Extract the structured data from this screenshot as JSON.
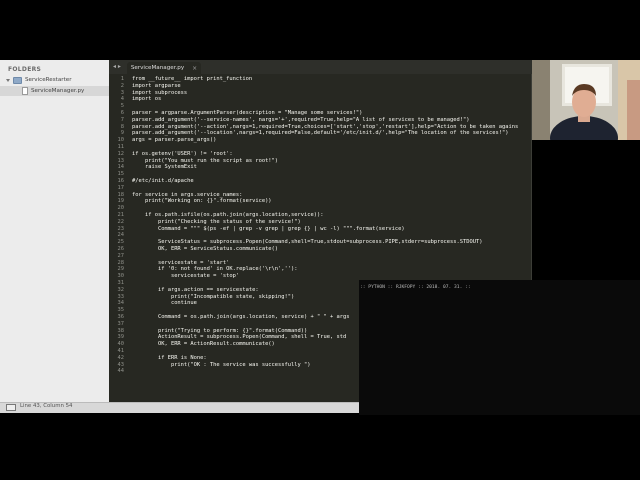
{
  "sidebar": {
    "title": "FOLDERS",
    "folder": "ServiceRestarter",
    "file": "ServiceManager.py"
  },
  "tab": {
    "label": "ServiceManager.py",
    "close": "×",
    "nav": "◂ ▸"
  },
  "status": {
    "text": "Line 43, Column 54"
  },
  "terminal": {
    "text": ":: PYTHON :: RJKFOPY :: 2018. 07. 31. ::"
  },
  "code_lines": [
    "from __future__ import print_function",
    "import argparse",
    "import subprocess",
    "import os",
    "",
    "parser = argparse.ArgumentParser(description = \"Manage some services!\")",
    "parser.add_argument('--service-names', nargs='+',required=True,help=\"A list of services to be managed!\")",
    "parser.add_argument('--action',nargs=1,required=True,choices=['start','stop','restart'],help=\"Action to be taken agains",
    "parser.add_argument('--location',nargs=1,required=False,default='/etc/init.d/',help=\"The location of the services!\")",
    "args = parser.parse_args()",
    "",
    "if os.getenv('USER') != 'root':",
    "    print(\"You must run the script as root!\")",
    "    raise SystemExit",
    "",
    "#/etc/init.d/apache",
    "",
    "for service in args.service_names:",
    "    print(\"Working on: {}\".format(service))",
    "",
    "    if os.path.isfile(os.path.join(args.location,service)):",
    "        print(\"Checking the status of the service!\")",
    "        Command = \"\"\" $(ps -ef | grep -v grep | grep {} | wc -l) \"\"\".format(service)",
    "",
    "        ServiceStatus = subprocess.Popen(Command,shell=True,stdout=subprocess.PIPE,stderr=subprocess.STDOUT)",
    "        OK, ERR = ServiceStatus.communicate()",
    "",
    "        servicestate = 'start'",
    "        if '0: not found' in OK.replace('\\r\\n',''):",
    "            servicestate = 'stop'",
    "",
    "        if args.action == servicestate:",
    "            print(\"Incompatible state, skipping!\")",
    "            continue",
    "",
    "        Command = os.path.join(args.location, service) + \" \" + args",
    "",
    "        print(\"Trying to perform: {}\".format(Command))",
    "        ActionResult = subprocess.Popen(Command, shell = True, std",
    "        OK, ERR = ActionResult.communicate()",
    "",
    "        if ERR is None:",
    "            print(\"OK : The service was successfully \")",
    ""
  ],
  "colors": {
    "editor_bg": "#272822",
    "sidebar_bg": "#ececec",
    "keyword": "#f92672",
    "string": "#e6db74",
    "function": "#66d9ef"
  }
}
